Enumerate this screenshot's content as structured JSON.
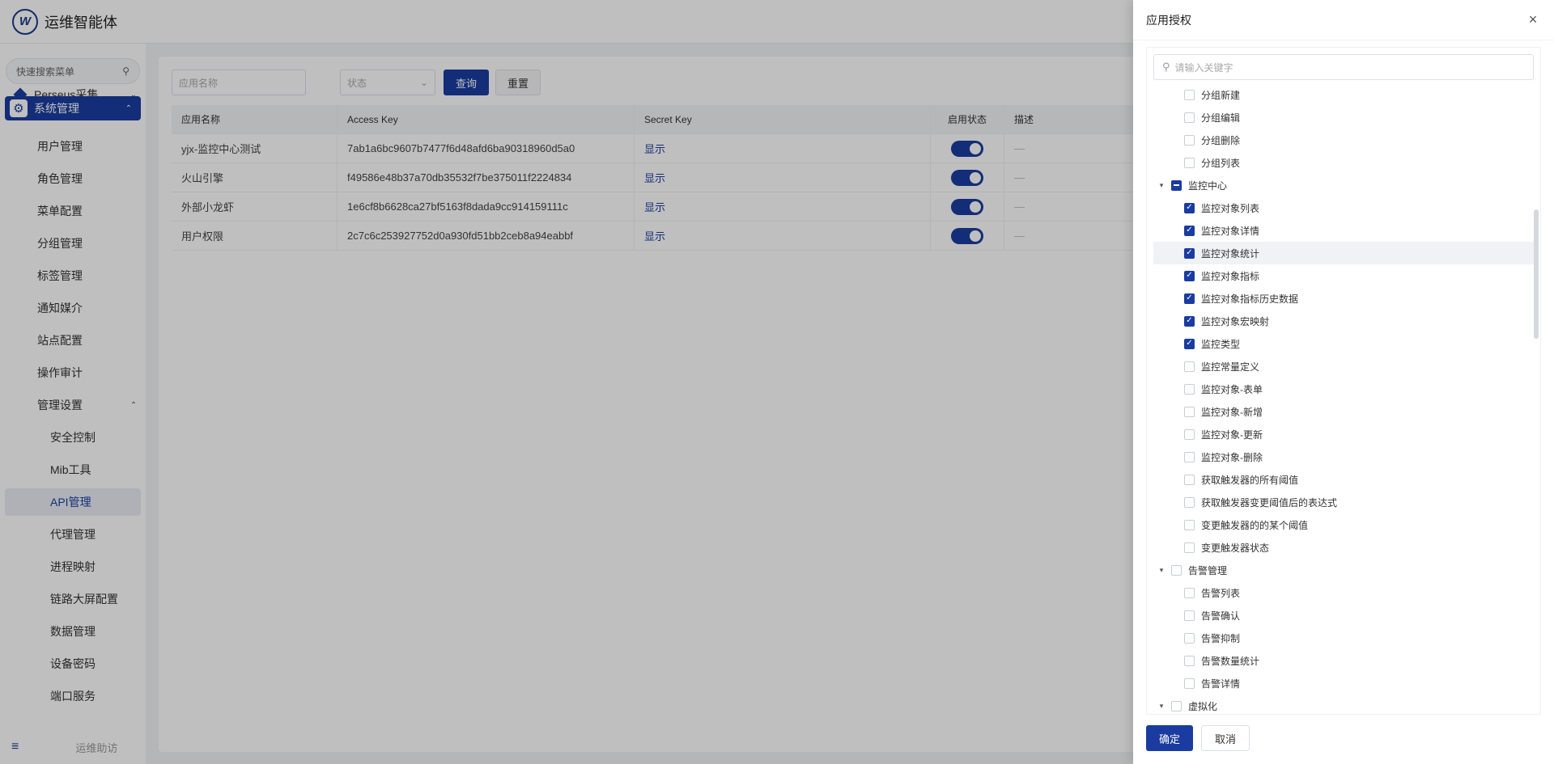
{
  "header": {
    "logo": "W",
    "title": "运维智能体"
  },
  "sidebar": {
    "search_label": "快速搜索菜单",
    "items": [
      {
        "label": "Perseus采集"
      },
      {
        "label": "系统管理"
      },
      {
        "label": "用户管理"
      },
      {
        "label": "角色管理"
      },
      {
        "label": "菜单配置"
      },
      {
        "label": "分组管理"
      },
      {
        "label": "标签管理"
      },
      {
        "label": "通知媒介"
      },
      {
        "label": "站点配置"
      },
      {
        "label": "操作审计"
      },
      {
        "label": "管理设置"
      },
      {
        "label": "安全控制"
      },
      {
        "label": "Mib工具"
      },
      {
        "label": "API管理"
      },
      {
        "label": "代理管理"
      },
      {
        "label": "进程映射"
      },
      {
        "label": "链路大屏配置"
      },
      {
        "label": "数据管理"
      },
      {
        "label": "设备密码"
      },
      {
        "label": "端口服务"
      }
    ],
    "footer_text": "运维助访"
  },
  "filters": {
    "name_placeholder": "应用名称",
    "status_placeholder": "状态",
    "query_label": "查询",
    "reset_label": "重置"
  },
  "table": {
    "headers": [
      "应用名称",
      "Access Key",
      "Secret Key",
      "启用状态",
      "描述"
    ],
    "rows": [
      {
        "name": "yjx-监控中心测试",
        "access_key": "7ab1a6bc9607b7477f6d48afd6ba90318960d5a0",
        "secret": "显示",
        "desc": "—"
      },
      {
        "name": "火山引擎",
        "access_key": "f49586e48b37a70db35532f7be375011f2224834",
        "secret": "显示",
        "desc": "—"
      },
      {
        "name": "外部小龙虾",
        "access_key": "1e6cf8b6628ca27bf5163f8dada9cc914159111c",
        "secret": "显示",
        "desc": "—"
      },
      {
        "name": "用户权限",
        "access_key": "2c7c6c253927752d0a930fd51bb2ceb8a94eabbf",
        "secret": "显示",
        "desc": "—"
      }
    ]
  },
  "drawer": {
    "title": "应用授权",
    "close": "×",
    "search_placeholder": "请输入关键字",
    "tree": [
      {
        "label": "分组新建",
        "level": 1,
        "state": "off"
      },
      {
        "label": "分组编辑",
        "level": 1,
        "state": "off"
      },
      {
        "label": "分组删除",
        "level": 1,
        "state": "off"
      },
      {
        "label": "分组列表",
        "level": 1,
        "state": "off"
      },
      {
        "label": "监控中心",
        "level": 0,
        "state": "half"
      },
      {
        "label": "监控对象列表",
        "level": 1,
        "state": "on"
      },
      {
        "label": "监控对象详情",
        "level": 1,
        "state": "on"
      },
      {
        "label": "监控对象统计",
        "level": 1,
        "state": "on",
        "highlight": true
      },
      {
        "label": "监控对象指标",
        "level": 1,
        "state": "on"
      },
      {
        "label": "监控对象指标历史数据",
        "level": 1,
        "state": "on"
      },
      {
        "label": "监控对象宏映射",
        "level": 1,
        "state": "on"
      },
      {
        "label": "监控类型",
        "level": 1,
        "state": "on"
      },
      {
        "label": "监控常量定义",
        "level": 1,
        "state": "off"
      },
      {
        "label": "监控对象-表单",
        "level": 1,
        "state": "off"
      },
      {
        "label": "监控对象-新增",
        "level": 1,
        "state": "off"
      },
      {
        "label": "监控对象-更新",
        "level": 1,
        "state": "off"
      },
      {
        "label": "监控对象-删除",
        "level": 1,
        "state": "off"
      },
      {
        "label": "获取触发器的所有阈值",
        "level": 1,
        "state": "off"
      },
      {
        "label": "获取触发器变更阈值后的表达式",
        "level": 1,
        "state": "off"
      },
      {
        "label": "变更触发器的的某个阈值",
        "level": 1,
        "state": "off"
      },
      {
        "label": "变更触发器状态",
        "level": 1,
        "state": "off"
      },
      {
        "label": "告警管理",
        "level": 0,
        "state": "off"
      },
      {
        "label": "告警列表",
        "level": 1,
        "state": "off"
      },
      {
        "label": "告警确认",
        "level": 1,
        "state": "off"
      },
      {
        "label": "告警抑制",
        "level": 1,
        "state": "off"
      },
      {
        "label": "告警数量统计",
        "level": 1,
        "state": "off"
      },
      {
        "label": "告警详情",
        "level": 1,
        "state": "off"
      },
      {
        "label": "虚拟化",
        "level": 0,
        "state": "off"
      }
    ],
    "ok_label": "确定",
    "cancel_label": "取消"
  },
  "icons": {
    "search": "search-icon",
    "chevron": "chevron-icon",
    "gear": "gear-icon",
    "close": "close-icon",
    "check": "check-icon"
  },
  "colors": {
    "primary": "#1a3ca0"
  }
}
